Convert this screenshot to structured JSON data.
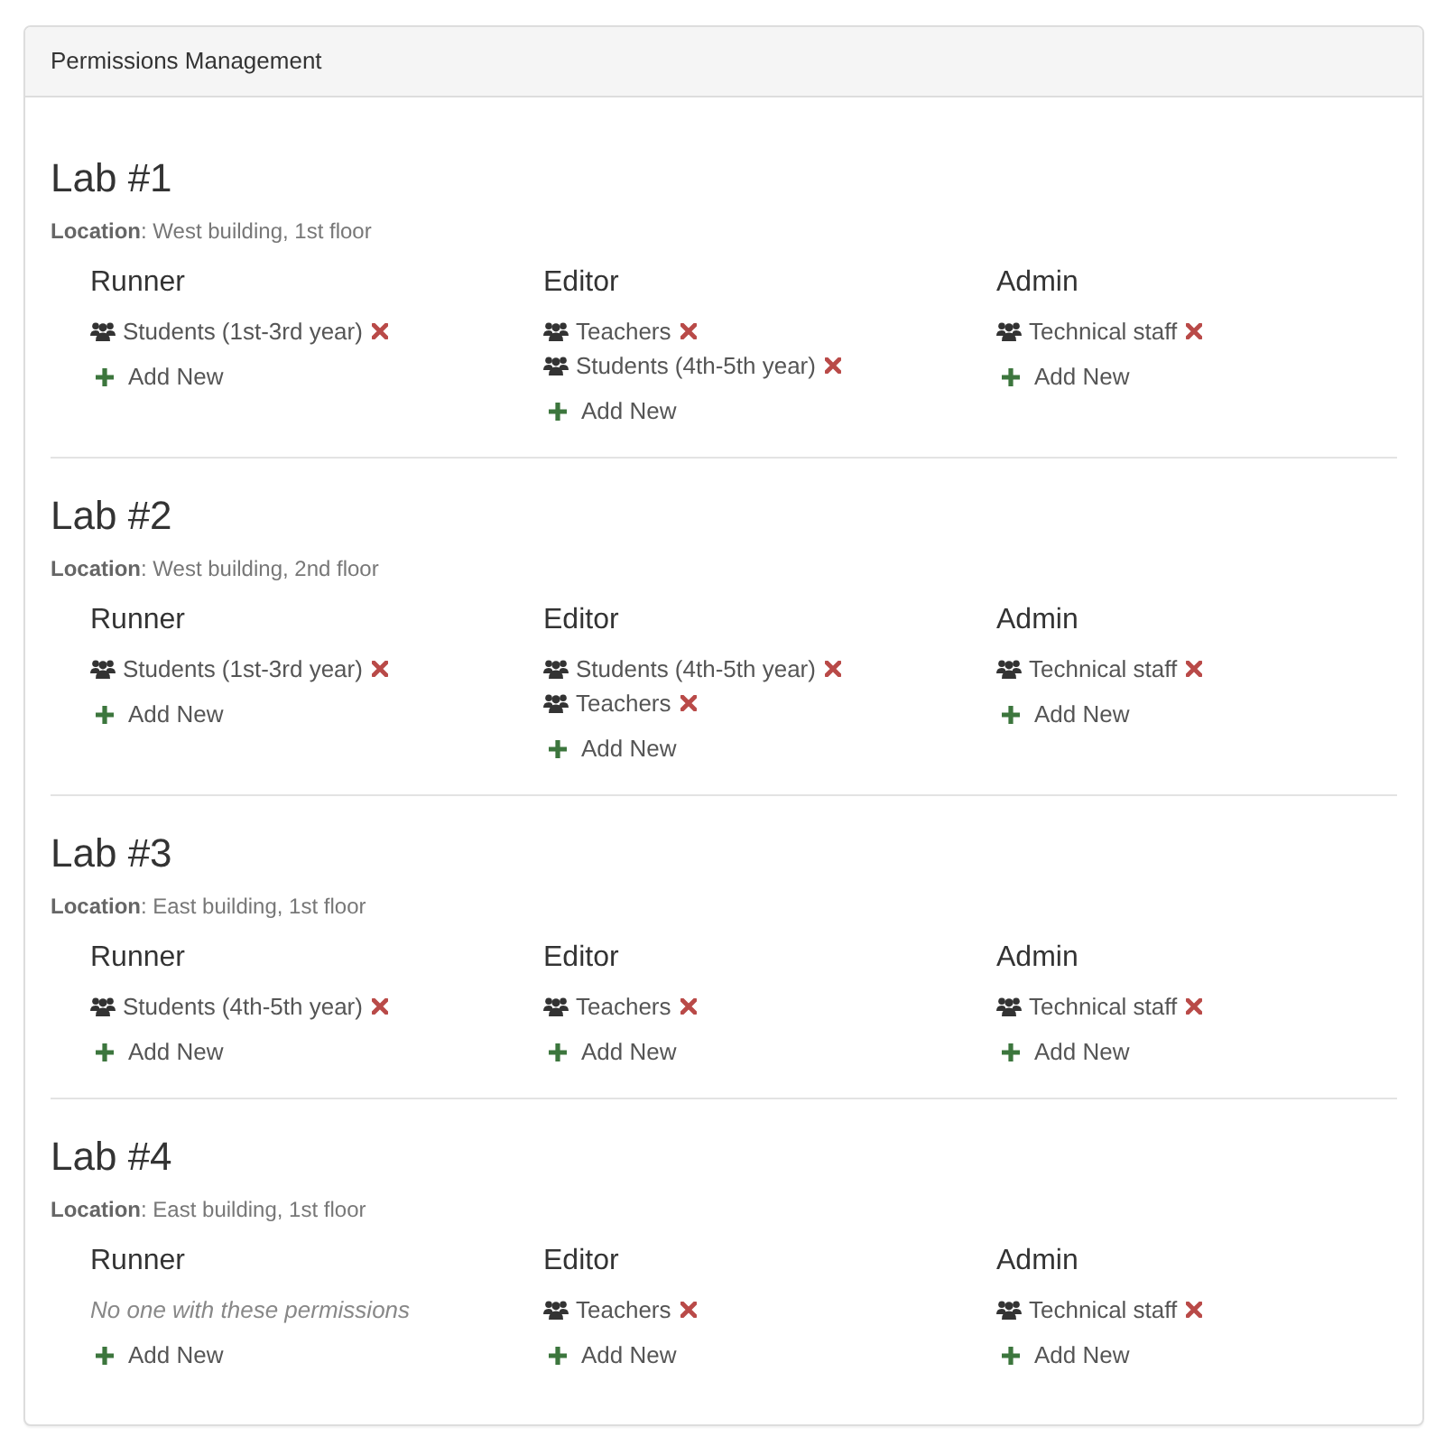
{
  "panel": {
    "title": "Permissions Management"
  },
  "labs": [
    {
      "name": "Lab #1",
      "location": "**Location**: West building, 1st floor",
      "roles": [
        {
          "name": "Runner",
          "members": [
            {
              "name": "Students (1st-3rd year)"
            }
          ],
          "add_label": "Add New"
        },
        {
          "name": "Editor",
          "members": [
            {
              "name": "Teachers"
            },
            {
              "name": "Students (4th-5th year)"
            }
          ],
          "add_label": "Add New"
        },
        {
          "name": "Admin",
          "members": [
            {
              "name": "Technical staff"
            }
          ],
          "add_label": "Add New"
        }
      ]
    },
    {
      "name": "Lab #2",
      "location": "**Location**: West building, 2nd floor",
      "roles": [
        {
          "name": "Runner",
          "members": [
            {
              "name": "Students (1st-3rd year)"
            }
          ],
          "add_label": "Add New"
        },
        {
          "name": "Editor",
          "members": [
            {
              "name": "Students (4th-5th year)"
            },
            {
              "name": "Teachers"
            }
          ],
          "add_label": "Add New"
        },
        {
          "name": "Admin",
          "members": [
            {
              "name": "Technical staff"
            }
          ],
          "add_label": "Add New"
        }
      ]
    },
    {
      "name": "Lab #3",
      "location": "**Location**: East building, 1st floor",
      "roles": [
        {
          "name": "Runner",
          "members": [
            {
              "name": "Students (4th-5th year)"
            }
          ],
          "add_label": "Add New"
        },
        {
          "name": "Editor",
          "members": [
            {
              "name": "Teachers"
            }
          ],
          "add_label": "Add New"
        },
        {
          "name": "Admin",
          "members": [
            {
              "name": "Technical staff"
            }
          ],
          "add_label": "Add New"
        }
      ]
    },
    {
      "name": "Lab #4",
      "location": "**Location**: East building, 1st floor",
      "roles": [
        {
          "name": "Runner",
          "empty_text": "No one with these permissions",
          "add_label": "Add New"
        },
        {
          "name": "Editor",
          "members": [
            {
              "name": "Teachers"
            }
          ],
          "add_label": "Add New"
        },
        {
          "name": "Admin",
          "members": [
            {
              "name": "Technical staff"
            }
          ],
          "add_label": "Add New"
        }
      ]
    }
  ]
}
